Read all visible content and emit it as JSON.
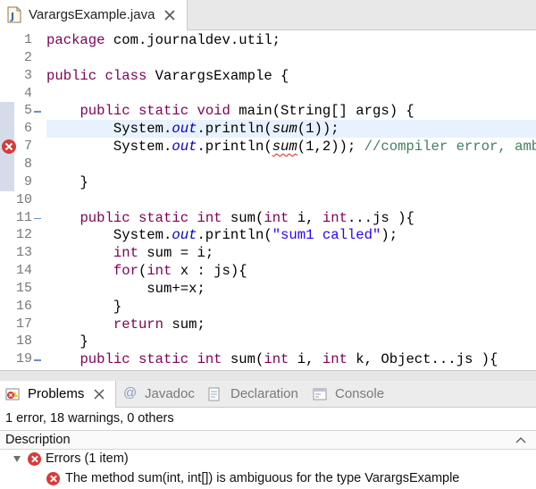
{
  "editor_tab": {
    "title": "VarargsExample.java",
    "icon": "java-file-icon",
    "close_icon": "close-icon"
  },
  "editor": {
    "lines": [
      {
        "num": "1",
        "fold": false,
        "error": false,
        "segments": [
          [
            "kw",
            "package"
          ],
          [
            "",
            " com.journaldev.util;"
          ]
        ]
      },
      {
        "num": "2",
        "fold": false,
        "error": false,
        "segments": []
      },
      {
        "num": "3",
        "fold": false,
        "error": false,
        "segments": [
          [
            "kw",
            "public"
          ],
          [
            "",
            " "
          ],
          [
            "kw",
            "class"
          ],
          [
            "",
            " VarargsExample {"
          ]
        ]
      },
      {
        "num": "4",
        "fold": false,
        "error": false,
        "segments": []
      },
      {
        "num": "5",
        "fold": true,
        "error": false,
        "segments": [
          [
            "",
            " "
          ],
          [
            "",
            " "
          ],
          [
            "",
            " "
          ],
          [
            "",
            " "
          ],
          [
            "kw",
            "public"
          ],
          [
            "",
            " "
          ],
          [
            "kw",
            "static"
          ],
          [
            "",
            " "
          ],
          [
            "kw",
            "void"
          ],
          [
            "",
            " main(String[] "
          ],
          [
            "",
            ""
          ],
          [
            "",
            "args) {"
          ]
        ]
      },
      {
        "num": "6",
        "fold": false,
        "error": false,
        "current": true,
        "segments": [
          [
            "",
            "        System."
          ],
          [
            "fld",
            "out"
          ],
          [
            "",
            ".println("
          ],
          [
            "itl",
            "sum"
          ],
          [
            "",
            "(1));"
          ]
        ]
      },
      {
        "num": "7",
        "fold": false,
        "error": true,
        "segments": [
          [
            "",
            "        System."
          ],
          [
            "fld",
            "out"
          ],
          [
            "",
            ".println("
          ],
          [
            "itl squig",
            "sum"
          ],
          [
            "",
            "(1,2)); "
          ],
          [
            "cmt",
            "//compiler error, ambiguous"
          ]
        ]
      },
      {
        "num": "8",
        "fold": false,
        "error": false,
        "segments": []
      },
      {
        "num": "9",
        "fold": false,
        "error": false,
        "segments": [
          [
            "",
            "    }"
          ]
        ]
      },
      {
        "num": "10",
        "fold": false,
        "error": false,
        "segments": []
      },
      {
        "num": "11",
        "fold": true,
        "error": false,
        "segments": [
          [
            "",
            "    "
          ],
          [
            "kw",
            "public"
          ],
          [
            "",
            " "
          ],
          [
            "kw",
            "static"
          ],
          [
            "",
            " "
          ],
          [
            "kw",
            "int"
          ],
          [
            "",
            " sum("
          ],
          [
            "kw",
            "int"
          ],
          [
            "",
            " i, "
          ],
          [
            "kw",
            "int"
          ],
          [
            "",
            "...js ){"
          ]
        ]
      },
      {
        "num": "12",
        "fold": false,
        "error": false,
        "segments": [
          [
            "",
            "        System."
          ],
          [
            "fld",
            "out"
          ],
          [
            "",
            ".println("
          ],
          [
            "str",
            "\"sum1 called\""
          ],
          [
            "",
            ");"
          ]
        ]
      },
      {
        "num": "13",
        "fold": false,
        "error": false,
        "segments": [
          [
            "",
            "        "
          ],
          [
            "kw",
            "int"
          ],
          [
            "",
            " sum = i;"
          ]
        ]
      },
      {
        "num": "14",
        "fold": false,
        "error": false,
        "segments": [
          [
            "",
            "        "
          ],
          [
            "kw",
            "for"
          ],
          [
            "",
            "("
          ],
          [
            "kw",
            "int"
          ],
          [
            "",
            " x : js){"
          ]
        ]
      },
      {
        "num": "15",
        "fold": false,
        "error": false,
        "segments": [
          [
            "",
            "            sum+=x;"
          ]
        ]
      },
      {
        "num": "16",
        "fold": false,
        "error": false,
        "segments": [
          [
            "",
            "        }"
          ]
        ]
      },
      {
        "num": "17",
        "fold": false,
        "error": false,
        "segments": [
          [
            "",
            "        "
          ],
          [
            "kw",
            "return"
          ],
          [
            "",
            " sum;"
          ]
        ]
      },
      {
        "num": "18",
        "fold": false,
        "error": false,
        "segments": [
          [
            "",
            "    }"
          ]
        ]
      },
      {
        "num": "19",
        "fold": true,
        "error": false,
        "segments": [
          [
            "",
            "    "
          ],
          [
            "kw",
            "public"
          ],
          [
            "",
            " "
          ],
          [
            "kw",
            "static"
          ],
          [
            "",
            " "
          ],
          [
            "kw",
            "int"
          ],
          [
            "",
            " sum("
          ],
          [
            "kw",
            "int"
          ],
          [
            "",
            " i, "
          ],
          [
            "kw",
            "int"
          ],
          [
            "",
            " k, Object...js ){"
          ]
        ]
      }
    ]
  },
  "views": {
    "tabs": [
      {
        "label": "Problems",
        "icon": "problems-icon",
        "active": true
      },
      {
        "label": "Javadoc",
        "icon": "at-sign-icon",
        "active": false
      },
      {
        "label": "Declaration",
        "icon": "declaration-icon",
        "active": false
      },
      {
        "label": "Console",
        "icon": "console-icon",
        "active": false
      }
    ]
  },
  "problems": {
    "summary": "1 error, 18 warnings, 0 others",
    "column_header": "Description",
    "groups": [
      {
        "label": "Errors (1 item)",
        "expanded": true,
        "items": [
          {
            "label": "The method sum(int, int[]) is ambiguous for the type VarargsExample"
          }
        ]
      }
    ]
  },
  "colors": {
    "keyword": "#7f0055",
    "field": "#0000c0",
    "string": "#2a00ff",
    "comment": "#3f7f5f",
    "error": "#d83a3a",
    "current_line": "#e8f2fe"
  }
}
